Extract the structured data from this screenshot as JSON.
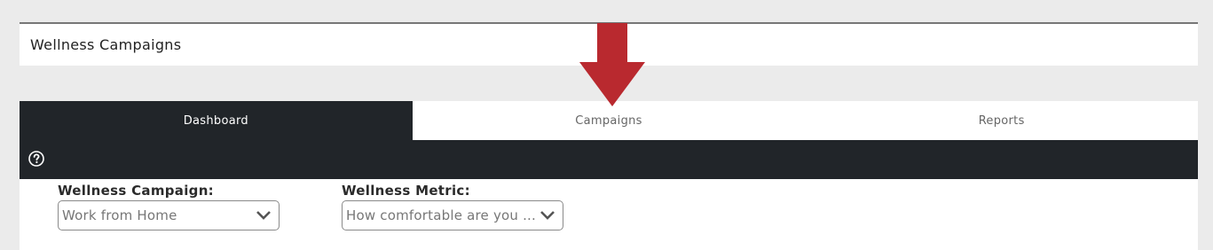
{
  "header": {
    "title": "Wellness Campaigns"
  },
  "tabs": [
    {
      "label": "Dashboard",
      "active": true
    },
    {
      "label": "Campaigns",
      "active": false
    },
    {
      "label": "Reports",
      "active": false
    }
  ],
  "toolbar": {
    "help_icon": "question-circle-icon"
  },
  "filters": {
    "campaign": {
      "label": "Wellness Campaign:",
      "value": "Work from Home"
    },
    "metric": {
      "label": "Wellness Metric:",
      "value": "How comfortable are you ..."
    }
  },
  "annotation": {
    "arrow_color": "#b9292f",
    "points_to": "Campaigns"
  },
  "colors": {
    "dark_bar": "#212529",
    "background": "#ebebeb",
    "arrow": "#b9292f"
  }
}
